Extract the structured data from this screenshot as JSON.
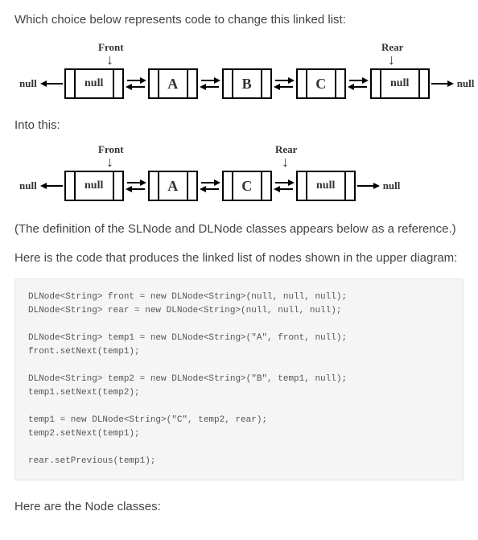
{
  "question": "Which choice below represents code to change this linked list:",
  "diagram1": {
    "frontLabel": "Front",
    "rearLabel": "Rear",
    "leftNull": "null",
    "rightNull": "null",
    "nodes": {
      "n0": "null",
      "a": "A",
      "b": "B",
      "c": "C",
      "n_end": "null"
    }
  },
  "intoThis": "Into this:",
  "diagram2": {
    "frontLabel": "Front",
    "rearLabel": "Rear",
    "leftNull": "null",
    "rightNull": "null",
    "nodes": {
      "n0": "null",
      "a": "A",
      "c": "C",
      "n_end": "null"
    }
  },
  "refNote": "(The definition of the SLNode and DLNode classes appears below as a reference.)",
  "setupText": "Here is the code that produces the linked list of nodes shown in the upper diagram:",
  "code": "DLNode<String> front = new DLNode<String>(null, null, null);\nDLNode<String> rear = new DLNode<String>(null, null, null);\n\nDLNode<String> temp1 = new DLNode<String>(\"A\", front, null);\nfront.setNext(temp1);\n\nDLNode<String> temp2 = new DLNode<String>(\"B\", temp1, null);\ntemp1.setNext(temp2);\n\ntemp1 = new DLNode<String>(\"C\", temp2, rear);\ntemp2.setNext(temp1);\n\nrear.setPrevious(temp1);",
  "nodeClassesHeading": "Here are the Node classes:"
}
